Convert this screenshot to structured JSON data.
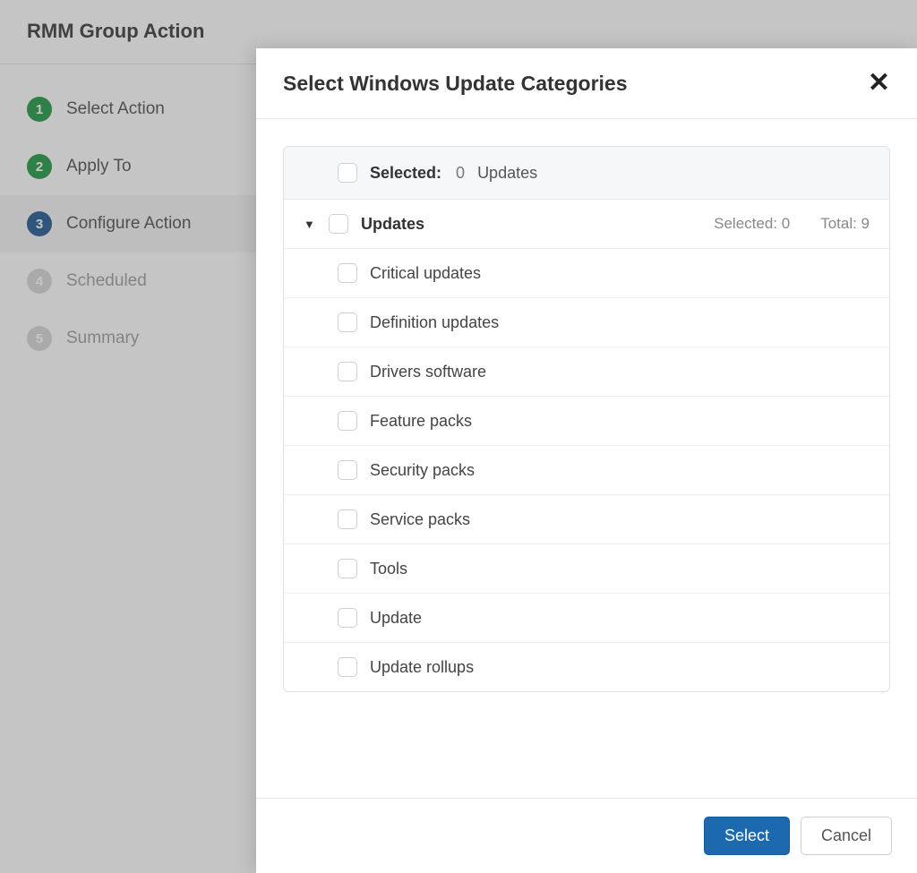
{
  "page": {
    "title": "RMM Group Action"
  },
  "wizard": {
    "steps": [
      {
        "num": "1",
        "label": "Select Action",
        "state": "done"
      },
      {
        "num": "2",
        "label": "Apply To",
        "state": "done"
      },
      {
        "num": "3",
        "label": "Configure Action",
        "state": "active"
      },
      {
        "num": "4",
        "label": "Scheduled",
        "state": "future"
      },
      {
        "num": "5",
        "label": "Summary",
        "state": "future"
      }
    ]
  },
  "modal": {
    "title": "Select Windows Update Categories",
    "header": {
      "selected_label": "Selected:",
      "selected_count": "0",
      "unit": "Updates"
    },
    "group": {
      "name": "Updates",
      "selected_label": "Selected: 0",
      "total_label": "Total: 9"
    },
    "categories": [
      "Critical updates",
      "Definition updates",
      "Drivers software",
      "Feature packs",
      "Security packs",
      "Service packs",
      "Tools",
      "Update",
      "Update rollups"
    ],
    "buttons": {
      "primary": "Select",
      "secondary": "Cancel"
    }
  }
}
